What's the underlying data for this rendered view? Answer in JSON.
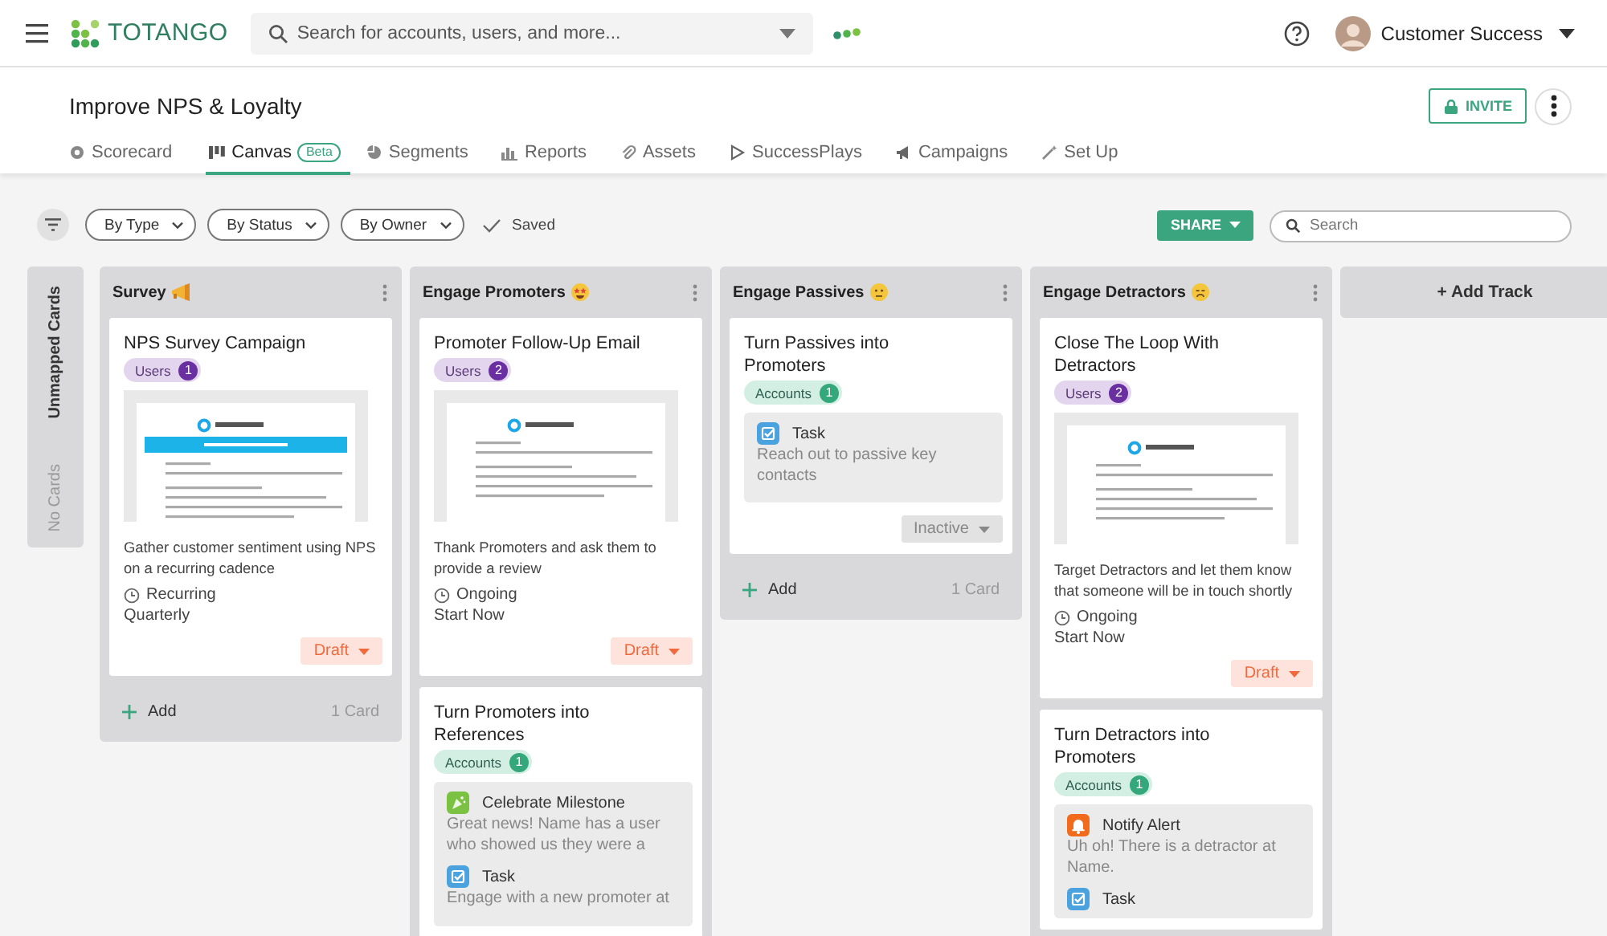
{
  "header": {
    "brand": "TOTANGO",
    "search": {
      "placeholder": "Search for accounts, users, and more..."
    },
    "user": "Customer Success"
  },
  "page": {
    "title": "Improve NPS & Loyalty",
    "invite": "INVITE"
  },
  "tabs": [
    {
      "label": "Scorecard",
      "selected": false
    },
    {
      "label": "Canvas",
      "selected": true,
      "badge": "Beta"
    },
    {
      "label": "Segments",
      "selected": false
    },
    {
      "label": "Reports",
      "selected": false
    },
    {
      "label": "Assets",
      "selected": false
    },
    {
      "label": "SuccessPlays",
      "selected": false
    },
    {
      "label": "Campaigns",
      "selected": false
    },
    {
      "label": "Set Up",
      "selected": false
    }
  ],
  "toolbar": {
    "filters": [
      "By Type",
      "By Status",
      "By Owner"
    ],
    "saved": "Saved",
    "share": "SHARE",
    "search": {
      "placeholder": "Search"
    }
  },
  "unmapped": {
    "title": "Unmapped Cards",
    "empty": "No Cards"
  },
  "tracks": [
    {
      "title": "Survey",
      "cards": [
        {
          "kind": "email",
          "title": "NPS Survey Campaign",
          "audience": {
            "kind": "users",
            "label": "Users",
            "count": "1"
          },
          "preview": {
            "banner": true
          },
          "description": "Gather customer sentiment using NPS on a recurring cadence",
          "schedule": "Recurring",
          "timing": "Quarterly",
          "status": {
            "kind": "draft",
            "label": "Draft"
          }
        }
      ],
      "footer": {
        "add": "Add",
        "count": "1 Card"
      }
    },
    {
      "title": "Engage Promoters",
      "cards": [
        {
          "kind": "email",
          "title": "Promoter Follow-Up Email",
          "audience": {
            "kind": "users",
            "label": "Users",
            "count": "2"
          },
          "preview": {
            "banner": false
          },
          "description": "Thank Promoters and ask them to provide a review",
          "schedule": "Ongoing",
          "timing": "Start Now",
          "status": {
            "kind": "draft",
            "label": "Draft"
          }
        },
        {
          "kind": "play",
          "title": "Turn Promoters into References",
          "audience": {
            "kind": "accounts",
            "label": "Accounts",
            "count": "1"
          },
          "steps": [
            {
              "kind": "celebrate",
              "title": "Celebrate Milestone",
              "text": "Great news!  Name has a user who showed us they were a"
            },
            {
              "kind": "task",
              "title": "Task",
              "text": "Engage with a new promoter at"
            }
          ]
        }
      ]
    },
    {
      "title": "Engage Passives",
      "cards": [
        {
          "kind": "play",
          "title": "Turn Passives into Promoters",
          "audience": {
            "kind": "accounts",
            "label": "Accounts",
            "count": "1"
          },
          "steps": [
            {
              "kind": "task",
              "title": "Task",
              "text": "Reach out to passive key contacts"
            }
          ],
          "status": {
            "kind": "inactive",
            "label": "Inactive"
          }
        }
      ],
      "footer": {
        "add": "Add",
        "count": "1 Card"
      }
    },
    {
      "title": "Engage Detractors",
      "cards": [
        {
          "kind": "email",
          "title": "Close The Loop With Detractors",
          "audience": {
            "kind": "users",
            "label": "Users",
            "count": "2"
          },
          "preview": {
            "banner": false
          },
          "description": "Target Detractors and let them know that someone will be in touch shortly",
          "schedule": "Ongoing",
          "timing": "Start Now",
          "status": {
            "kind": "draft",
            "label": "Draft"
          }
        },
        {
          "kind": "play",
          "title": "Turn Detractors into Promoters",
          "audience": {
            "kind": "accounts",
            "label": "Accounts",
            "count": "1"
          },
          "steps": [
            {
              "kind": "alert",
              "title": "Notify Alert",
              "text": "Uh oh! There is a detractor at  Name."
            },
            {
              "kind": "task",
              "title": "Task"
            }
          ]
        }
      ]
    }
  ],
  "add_track": "+ Add Track"
}
